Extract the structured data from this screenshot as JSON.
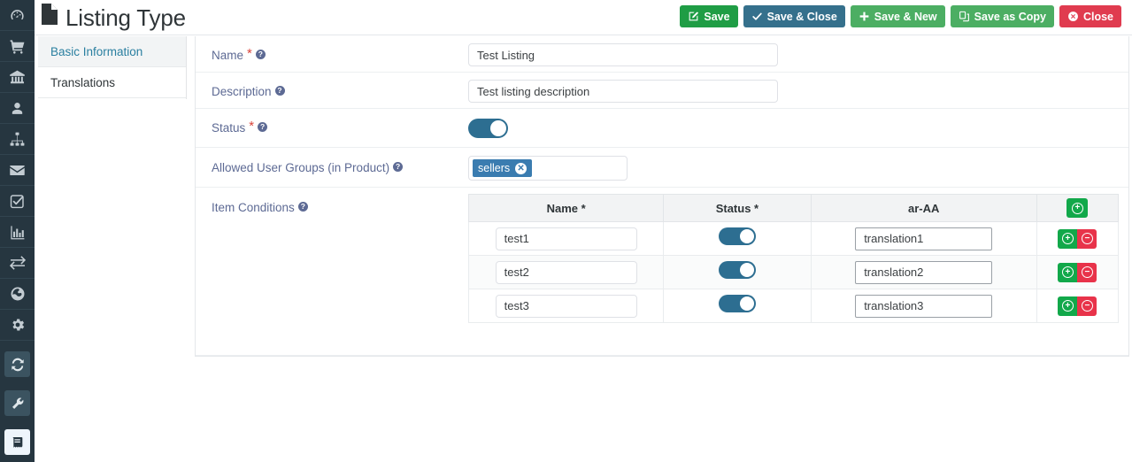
{
  "header": {
    "title": "Listing Type",
    "title_icon": "file-icon"
  },
  "toolbar": {
    "buttons": [
      {
        "label": "Save",
        "icon": "edit-pencil-icon",
        "color": "#1f9d45"
      },
      {
        "label": "Save & Close",
        "icon": "check-icon",
        "color": "#35708c"
      },
      {
        "label": "Save & New",
        "icon": "plus-icon",
        "color": "#4cae63"
      },
      {
        "label": "Save as Copy",
        "icon": "copy-icon",
        "color": "#4cae63"
      },
      {
        "label": "Close",
        "icon": "close-circle-icon",
        "color": "#e03b4f"
      }
    ]
  },
  "sidebar": {
    "items": [
      {
        "icon": "dashboard-gauge-icon"
      },
      {
        "icon": "shopping-cart-icon"
      },
      {
        "icon": "bank-icon"
      },
      {
        "icon": "user-icon"
      },
      {
        "icon": "sitemap-icon"
      },
      {
        "icon": "envelope-icon"
      },
      {
        "icon": "check-square-icon"
      },
      {
        "icon": "bar-chart-icon"
      },
      {
        "icon": "exchange-arrows-icon"
      },
      {
        "icon": "globe-icon"
      },
      {
        "icon": "gear-icon"
      },
      {
        "icon": "sync-refresh-icon"
      },
      {
        "icon": "wrench-icon"
      },
      {
        "icon": "book-icon"
      }
    ]
  },
  "tabs": [
    {
      "label": "Basic Information",
      "active": true
    },
    {
      "label": "Translations",
      "active": false
    }
  ],
  "form": {
    "name": {
      "label": "Name",
      "required": true,
      "help": "?",
      "value": "Test Listing",
      "placeholder": ""
    },
    "description": {
      "label": "Description",
      "required": false,
      "help": "?",
      "value": "Test listing description",
      "placeholder": ""
    },
    "status": {
      "label": "Status",
      "required": true,
      "help": "?",
      "value": "on"
    },
    "allowed_user_groups": {
      "label": "Allowed User Groups (in Product)",
      "required": false,
      "help": "?",
      "tags": [
        {
          "label": "sellers",
          "remove_icon": "close-circle-icon"
        }
      ]
    },
    "item_conditions": {
      "label": "Item Conditions",
      "required": false,
      "help": "?",
      "columns": [
        {
          "label": "Name",
          "required": true
        },
        {
          "label": "Status",
          "required": true
        },
        {
          "label": "ar-AA",
          "required": false
        },
        {
          "label": "",
          "required": false,
          "add_icon": "plus-circle-icon"
        }
      ],
      "rows": [
        {
          "name": "test1",
          "status": "on",
          "translation": "translation1",
          "add_icon": "plus-circle-icon",
          "remove_icon": "minus-circle-icon"
        },
        {
          "name": "test2",
          "status": "on",
          "translation": "translation2",
          "add_icon": "plus-circle-icon",
          "remove_icon": "minus-circle-icon"
        },
        {
          "name": "test3",
          "status": "on",
          "translation": "translation3",
          "add_icon": "plus-circle-icon",
          "remove_icon": "minus-circle-icon"
        }
      ]
    }
  },
  "colors": {
    "rail_bg": "#263640",
    "accent_teal": "#2d6e91",
    "tag_blue": "#3a7cb0",
    "green": "#12a84a",
    "red": "#e8334a",
    "label_text": "#5d6a94",
    "required_star": "#d9453c"
  },
  "symbols": {
    "star": "*",
    "question": "?",
    "plus": "+",
    "minus": "−",
    "times": "✕",
    "check": "✔"
  }
}
